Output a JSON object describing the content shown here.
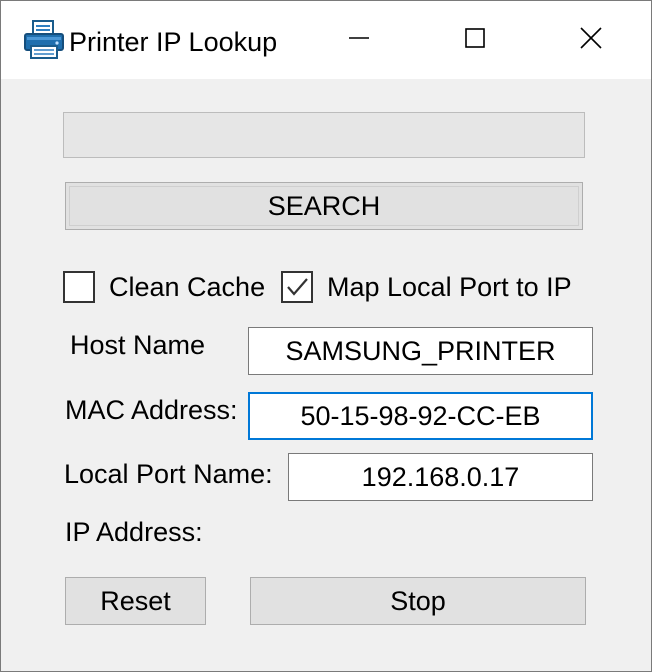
{
  "window": {
    "title": "Printer IP Lookup",
    "app_icon": "printer-icon",
    "controls": {
      "minimize_icon": "minimize-icon",
      "maximize_icon": "maximize-icon",
      "close_icon": "close-icon"
    }
  },
  "progress": {
    "value": 0
  },
  "buttons": {
    "search_label": "SEARCH",
    "reset_label": "Reset",
    "stop_label": "Stop"
  },
  "options": {
    "clean_cache_label": "Clean Cache",
    "clean_cache_checked": false,
    "map_port_label": "Map Local Port to IP",
    "map_port_checked": true
  },
  "fields": {
    "host_name_label": "Host Name",
    "host_name_value": "SAMSUNG_PRINTER",
    "mac_address_label": "MAC Address:",
    "mac_address_value": "50-15-98-92-CC-EB",
    "local_port_label": "Local Port Name:",
    "local_port_value": "192.168.0.17",
    "ip_address_label": "IP Address:"
  },
  "colors": {
    "focus_border": "#0078d7",
    "window_background": "#f0f0f0",
    "button_background": "#e1e1e1"
  }
}
